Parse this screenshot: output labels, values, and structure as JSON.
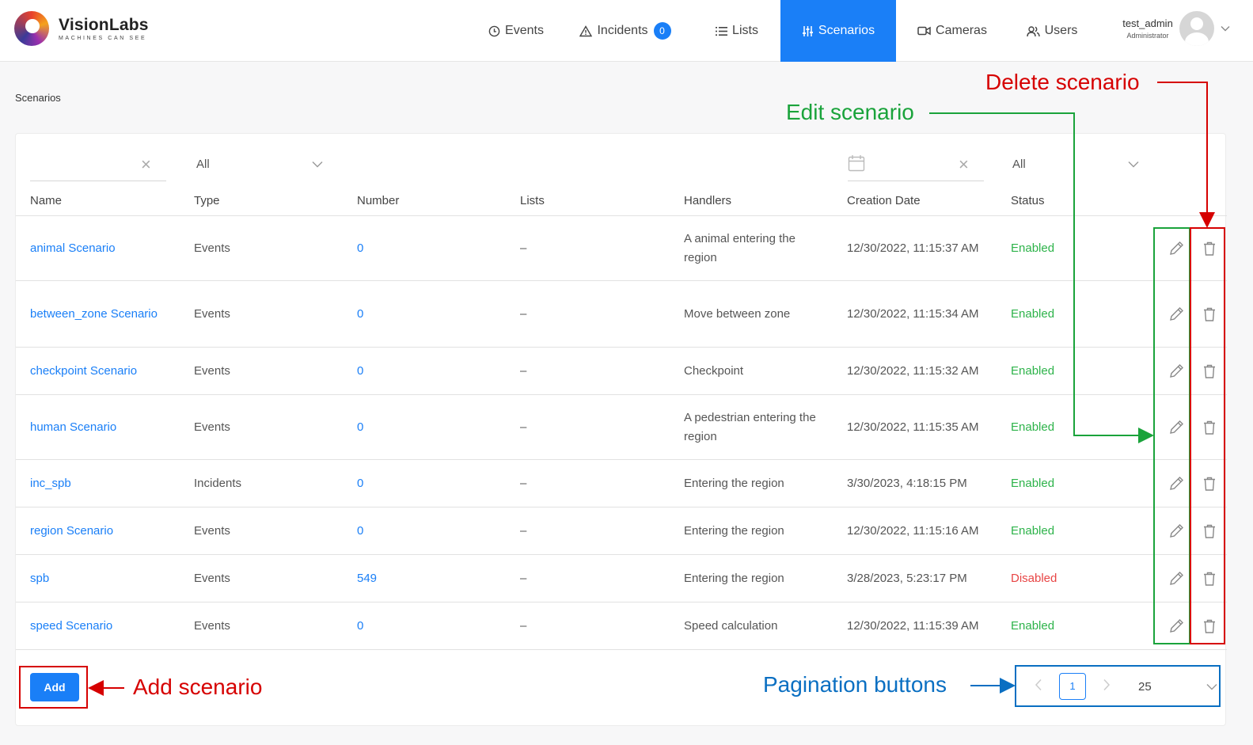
{
  "header": {
    "brand": "VisionLabs",
    "tagline": "MACHINES CAN SEE",
    "nav": {
      "events": "Events",
      "incidents": "Incidents",
      "incidents_count": "0",
      "lists": "Lists",
      "scenarios": "Scenarios",
      "cameras": "Cameras",
      "users": "Users"
    },
    "user": {
      "name": "test_admin",
      "role": "Administrator"
    }
  },
  "breadcrumb": "Scenarios",
  "filters": {
    "name_value": "",
    "type_value": "All",
    "date_value": "",
    "status_value": "All"
  },
  "table": {
    "headers": {
      "name": "Name",
      "type": "Type",
      "number": "Number",
      "lists": "Lists",
      "handlers": "Handlers",
      "creation_date": "Creation Date",
      "status": "Status"
    },
    "rows": [
      {
        "name": "animal Scenario",
        "type": "Events",
        "number": "0",
        "lists": "–",
        "handlers": "A animal entering the region",
        "date": "12/30/2022, 11:15:37 AM",
        "status": "Enabled"
      },
      {
        "name": "between_zone Scenario",
        "type": "Events",
        "number": "0",
        "lists": "–",
        "handlers": "Move between zone",
        "date": "12/30/2022, 11:15:34 AM",
        "status": "Enabled"
      },
      {
        "name": "checkpoint Scenario",
        "type": "Events",
        "number": "0",
        "lists": "–",
        "handlers": "Checkpoint",
        "date": "12/30/2022, 11:15:32 AM",
        "status": "Enabled"
      },
      {
        "name": "human Scenario",
        "type": "Events",
        "number": "0",
        "lists": "–",
        "handlers": "A pedestrian entering the region",
        "date": "12/30/2022, 11:15:35 AM",
        "status": "Enabled"
      },
      {
        "name": "inc_spb",
        "type": "Incidents",
        "number": "0",
        "lists": "–",
        "handlers": "Entering the region",
        "date": "3/30/2023, 4:18:15 PM",
        "status": "Enabled"
      },
      {
        "name": "region Scenario",
        "type": "Events",
        "number": "0",
        "lists": "–",
        "handlers": "Entering the region",
        "date": "12/30/2022, 11:15:16 AM",
        "status": "Enabled"
      },
      {
        "name": "spb",
        "type": "Events",
        "number": "549",
        "lists": "–",
        "handlers": "Entering the region",
        "date": "3/28/2023, 5:23:17 PM",
        "status": "Disabled"
      },
      {
        "name": "speed Scenario",
        "type": "Events",
        "number": "0",
        "lists": "–",
        "handlers": "Speed calculation",
        "date": "12/30/2022, 11:15:39 AM",
        "status": "Enabled"
      }
    ]
  },
  "footer": {
    "add_label": "Add",
    "current_page": "1",
    "page_size": "25"
  },
  "annotations": {
    "delete": "Delete scenario",
    "edit": "Edit scenario",
    "add": "Add scenario",
    "pagination": "Pagination buttons"
  },
  "colors": {
    "accent": "#1a7ff7",
    "enabled": "#2db34a",
    "disabled": "#e84545",
    "anno_red": "#d60000",
    "anno_green": "#1aa33b",
    "anno_blue": "#0a6fc2"
  }
}
